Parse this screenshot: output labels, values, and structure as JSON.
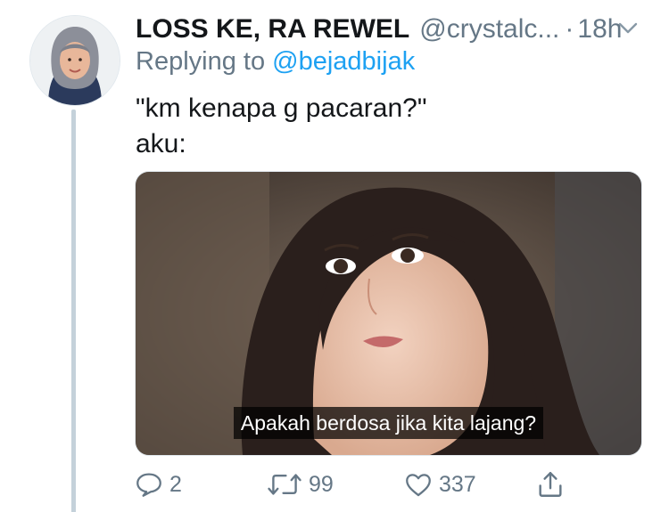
{
  "tweet": {
    "author_name": "LOSS KE, RA REWEL",
    "author_handle": "@crystalc...",
    "separator": "·",
    "timestamp": "18h",
    "replying_prefix": "Replying to ",
    "replying_to": "@bejadbijak",
    "text_line1": "\"km kenapa g pacaran?\"",
    "text_line2": "aku:",
    "media": {
      "subtitle": "Apakah berdosa jika kita lajang?"
    },
    "actions": {
      "reply_count": "2",
      "retweet_count": "99",
      "like_count": "337"
    }
  },
  "colors": {
    "secondary_text": "#657786",
    "link": "#1da1f2",
    "thread_line": "#c4d1da"
  },
  "icons": [
    "avatar",
    "chevron-down-icon",
    "reply-icon",
    "retweet-icon",
    "like-icon",
    "share-icon"
  ]
}
